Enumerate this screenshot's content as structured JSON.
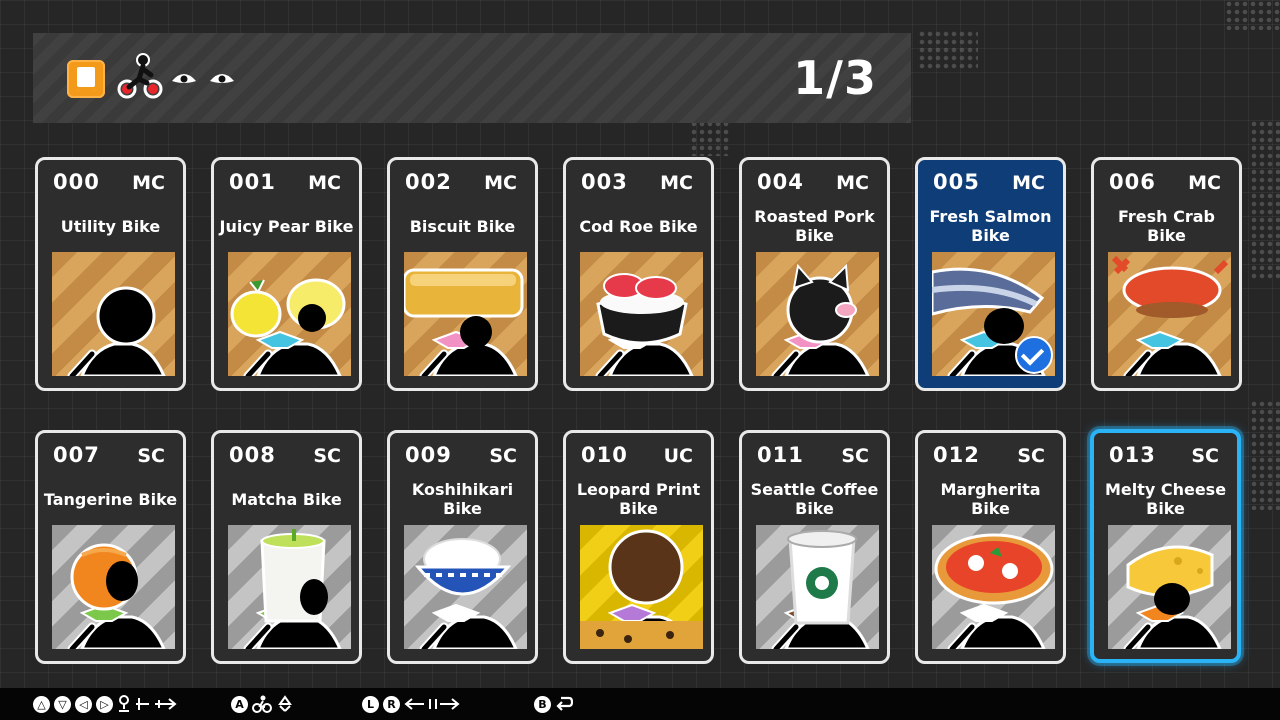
{
  "header": {
    "page_counter": "1/3",
    "icons": [
      "book-icon",
      "bike-rider-icon",
      "eye-icon",
      "eye-icon"
    ]
  },
  "cards": [
    {
      "number": "000",
      "rank": "MC",
      "name": "Utility Bike",
      "art": "silhouette",
      "bg": "gold",
      "state": "normal"
    },
    {
      "number": "001",
      "rank": "MC",
      "name": "Juicy Pear Bike",
      "art": "pear",
      "bg": "gold",
      "state": "normal"
    },
    {
      "number": "002",
      "rank": "MC",
      "name": "Biscuit Bike",
      "art": "biscuit",
      "bg": "gold",
      "state": "normal"
    },
    {
      "number": "003",
      "rank": "MC",
      "name": "Cod Roe Bike",
      "art": "codroe",
      "bg": "gold",
      "state": "normal"
    },
    {
      "number": "004",
      "rank": "MC",
      "name": "Roasted Pork Bike",
      "art": "pig",
      "bg": "gold",
      "state": "normal"
    },
    {
      "number": "005",
      "rank": "MC",
      "name": "Fresh Salmon Bike",
      "art": "salmon",
      "bg": "gold",
      "state": "selected"
    },
    {
      "number": "006",
      "rank": "MC",
      "name": "Fresh Crab Bike",
      "art": "crab",
      "bg": "gold",
      "state": "normal"
    },
    {
      "number": "007",
      "rank": "SC",
      "name": "Tangerine Bike",
      "art": "tangerine",
      "bg": "silver",
      "state": "normal"
    },
    {
      "number": "008",
      "rank": "SC",
      "name": "Matcha Bike",
      "art": "matcha",
      "bg": "silver",
      "state": "normal"
    },
    {
      "number": "009",
      "rank": "SC",
      "name": "Koshihikari Bike",
      "art": "rice",
      "bg": "silver",
      "state": "normal"
    },
    {
      "number": "010",
      "rank": "UC",
      "name": "Leopard Print Bike",
      "art": "leopard",
      "bg": "yellow",
      "state": "normal"
    },
    {
      "number": "011",
      "rank": "SC",
      "name": "Seattle Coffee Bike",
      "art": "coffee",
      "bg": "silver",
      "state": "normal"
    },
    {
      "number": "012",
      "rank": "SC",
      "name": "Margherita Bike",
      "art": "pizza",
      "bg": "silver",
      "state": "normal"
    },
    {
      "number": "013",
      "rank": "SC",
      "name": "Melty Cheese Bike",
      "art": "cheese",
      "bg": "silver",
      "state": "focused"
    }
  ],
  "footer": {
    "navigate_buttons": [
      "△",
      "▽",
      "◁",
      "▷"
    ],
    "a_button": "A",
    "lr_buttons": [
      "L",
      "R"
    ],
    "b_button": "B"
  },
  "colors": {
    "selected_card": "#0f3d78",
    "focus_ring": "#2ab3f5",
    "check_badge": "#1e6fe0",
    "book_icon": "#f49a1a"
  }
}
